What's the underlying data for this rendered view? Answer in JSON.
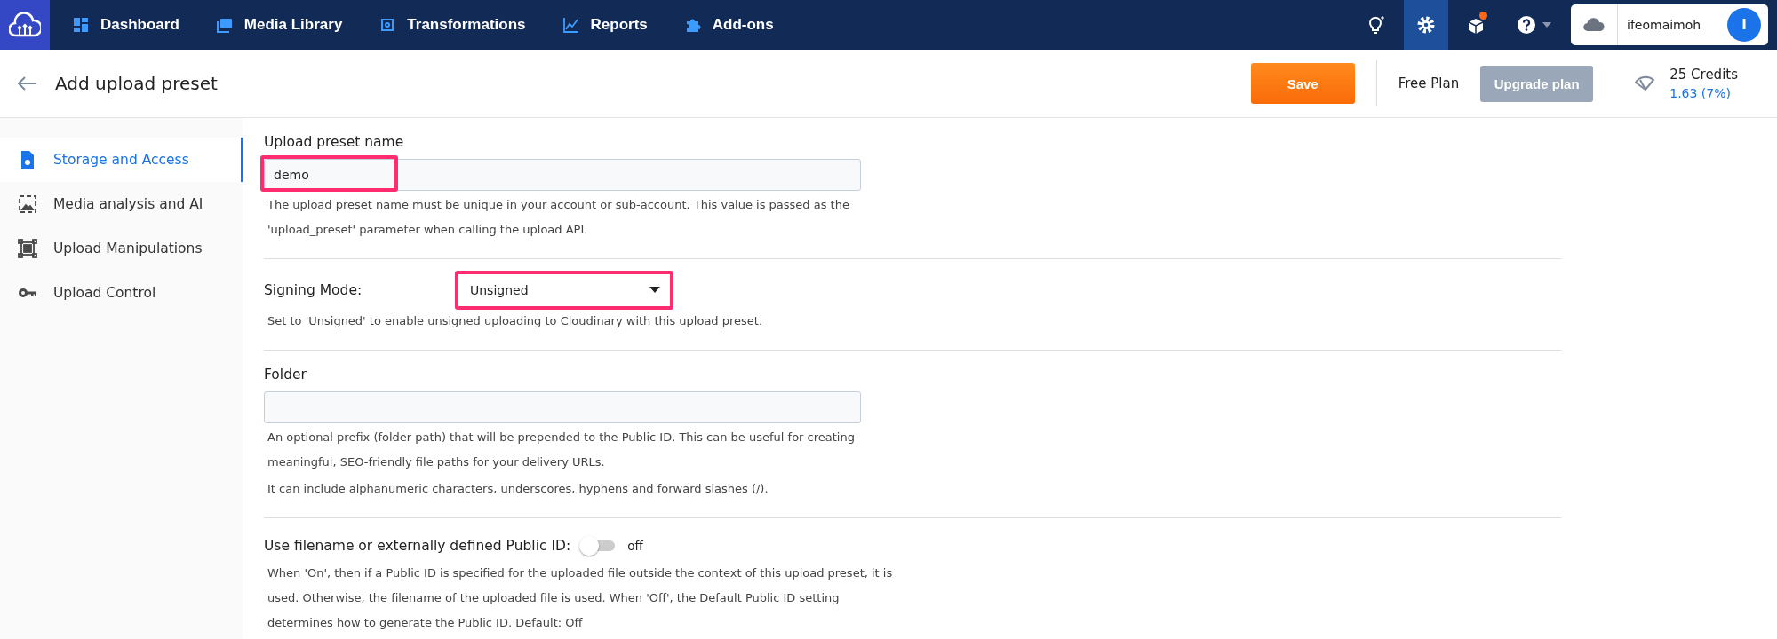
{
  "topbar": {
    "nav": [
      {
        "label": "Dashboard"
      },
      {
        "label": "Media Library"
      },
      {
        "label": "Transformations"
      },
      {
        "label": "Reports"
      },
      {
        "label": "Add-ons"
      }
    ],
    "tools": [
      {
        "selected": false,
        "badge": false
      },
      {
        "selected": true,
        "badge": false
      },
      {
        "selected": false,
        "badge": true
      },
      {
        "selected": false,
        "badge": false
      }
    ],
    "account": {
      "name": "ifeomaimoh",
      "initial": "I"
    }
  },
  "header": {
    "title": "Add upload preset",
    "save": "Save",
    "plan": "Free Plan",
    "upgrade": "Upgrade plan",
    "credits": "25 Credits",
    "usage": "1.63 (7%)"
  },
  "sidebar": {
    "items": [
      {
        "label": "Storage and Access",
        "selected": true
      },
      {
        "label": "Media analysis and AI",
        "selected": false
      },
      {
        "label": "Upload Manipulations",
        "selected": false
      },
      {
        "label": "Upload Control",
        "selected": false
      }
    ]
  },
  "sections": [
    {
      "kind": "text",
      "label": "Upload preset name",
      "value": "demo",
      "highlighted": true,
      "hint": [
        "The upload preset name must be unique in your account or sub-account. This value is passed as the 'upload_preset' parameter when calling the upload API."
      ]
    },
    {
      "kind": "select",
      "label": "Signing Mode:",
      "value": "Unsigned",
      "highlighted": true,
      "hint": [
        "Set to 'Unsigned' to enable unsigned uploading to Cloudinary with this upload preset."
      ]
    },
    {
      "kind": "text",
      "label": "Folder",
      "highlighted": false,
      "hint": [
        "An optional prefix (folder path) that will be prepended to the Public ID. This can be useful for creating meaningful, SEO-friendly file paths for your delivery URLs.",
        "It can include alphanumeric characters, underscores, hyphens and forward slashes (/)."
      ]
    },
    {
      "kind": "toggle",
      "label": "Use filename or externally defined Public ID:",
      "on": false,
      "state": "off",
      "hint": [
        "When 'On', then if a Public ID is specified for the uploaded file outside the context of this upload preset, it is used. Otherwise, the filename of the uploaded file is used. When 'Off', the Default Public ID setting determines how to generate the Public ID. Default: Off"
      ]
    }
  ]
}
